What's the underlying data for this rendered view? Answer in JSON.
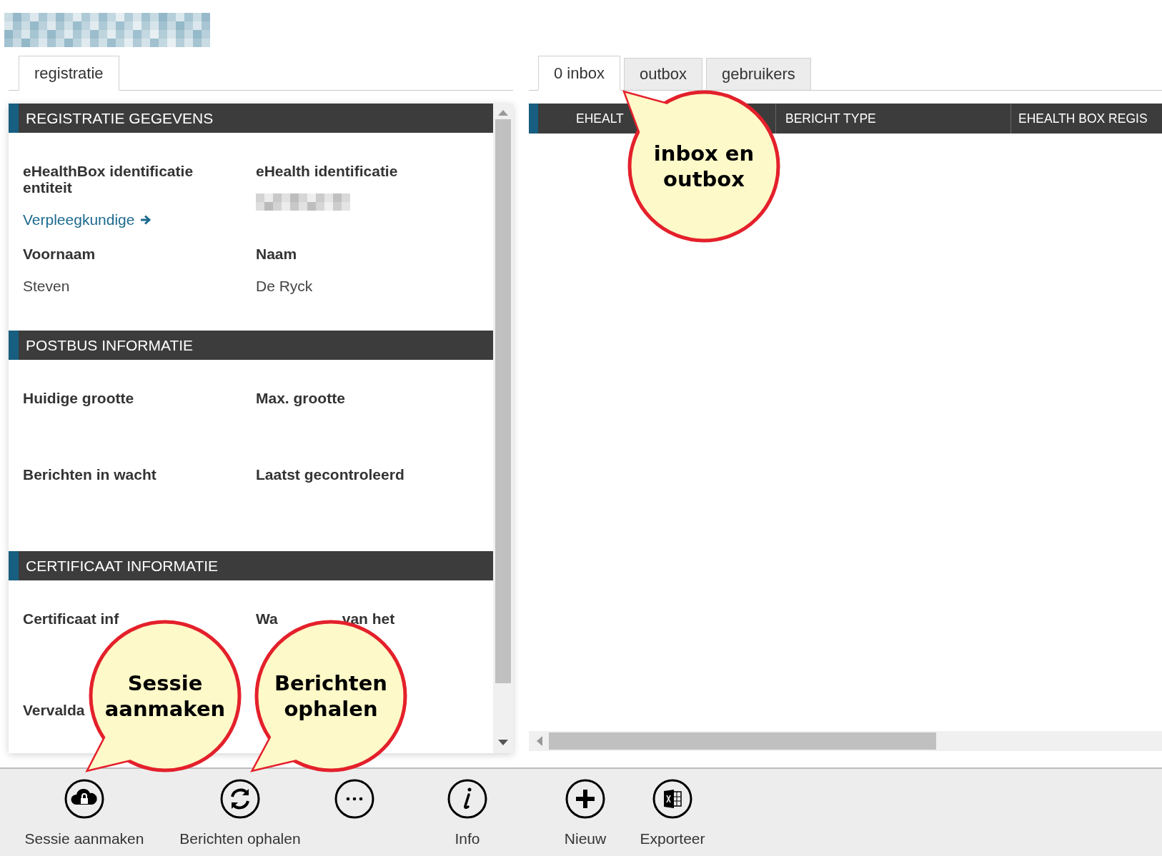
{
  "left_tabs": [
    {
      "label": "registratie",
      "selected": true
    }
  ],
  "sections": [
    {
      "title": "REGISTRATIE GEGEVENS",
      "fields": [
        {
          "kind": "link",
          "label": "eHealthBox identificatie entiteit",
          "value": "Verpleegkundige"
        },
        {
          "kind": "redacted",
          "label": "eHealth identificatie"
        },
        {
          "kind": "text",
          "label": "Voornaam",
          "value": "Steven"
        },
        {
          "kind": "text",
          "label": "Naam",
          "value": "De Ryck"
        }
      ]
    },
    {
      "title": "POSTBUS INFORMATIE",
      "fields": [
        {
          "kind": "text",
          "label": "Huidige grootte"
        },
        {
          "kind": "text",
          "label": "Max. grootte"
        },
        {
          "kind": "text",
          "label": "Berichten in wacht"
        },
        {
          "kind": "text",
          "label": "Laatst gecontroleerd"
        }
      ]
    },
    {
      "title": "CERTIFICAAT INFORMATIE",
      "fields": [
        {
          "kind": "text",
          "label": "Certificaat inf"
        },
        {
          "kind": "parts",
          "label_parts": [
            "Wa",
            "van het"
          ]
        },
        {
          "kind": "text",
          "label": "Vervalda"
        }
      ]
    }
  ],
  "right_tabs": [
    {
      "label": "0 inbox",
      "selected": true
    },
    {
      "label": "outbox",
      "selected": false
    },
    {
      "label": "gebruikers",
      "selected": false
    }
  ],
  "table": {
    "columns": [
      "EHEALT",
      "BERICHT TYPE",
      "EHEALTH BOX REGIS"
    ]
  },
  "callouts": [
    {
      "text": "inbox en outbox"
    },
    {
      "text": "Sessie aanmaken"
    },
    {
      "text": "Berichten ophalen"
    }
  ],
  "toolbar": [
    {
      "kind": "cloud-lock",
      "label": "Sessie aanmaken"
    },
    {
      "kind": "refresh",
      "label": "Berichten ophalen"
    },
    {
      "kind": "more"
    },
    {
      "kind": "info",
      "label": "Info"
    },
    {
      "kind": "plus",
      "label": "Nieuw"
    },
    {
      "kind": "excel",
      "label": "Exporteer"
    }
  ]
}
